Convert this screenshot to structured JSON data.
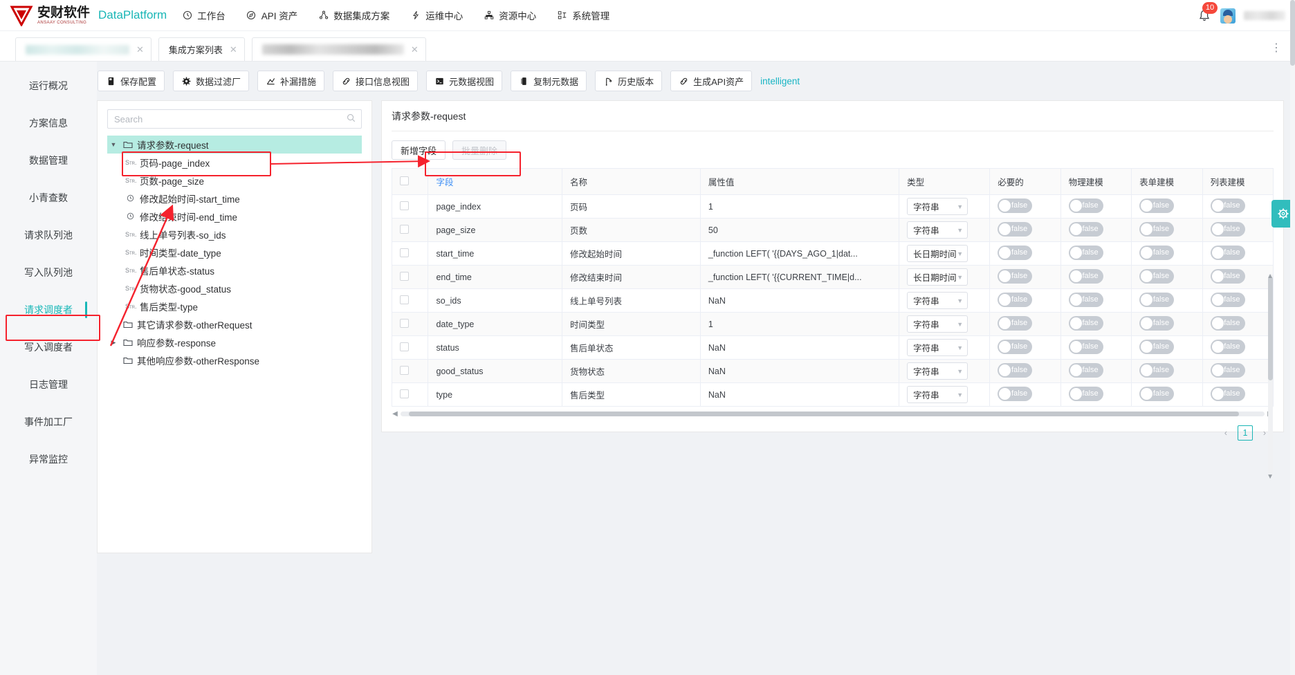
{
  "topnav": {
    "brand_cn": "安财软件",
    "brand_sub": "ANSAAY CONSULTING",
    "brand_platform": "DataPlatform",
    "items": [
      {
        "label": "工作台",
        "icon": "clock-icon"
      },
      {
        "label": "API 资产",
        "icon": "compass-icon"
      },
      {
        "label": "数据集成方案",
        "icon": "sitemap-icon"
      },
      {
        "label": "运维中心",
        "icon": "lightning-icon"
      },
      {
        "label": "资源中心",
        "icon": "hierarchy-icon"
      },
      {
        "label": "系统管理",
        "icon": "grid-icon"
      }
    ],
    "notification_count": "10",
    "bell_icon": "bell-icon",
    "avatar_icon": "user-avatar"
  },
  "tabs": {
    "items": [
      {
        "label": "",
        "blurred": true,
        "closable": true
      },
      {
        "label": "集成方案列表",
        "blurred": false,
        "closable": true
      },
      {
        "label": "",
        "blurred": true,
        "closable": true
      }
    ],
    "more_icon": "more-vertical-icon"
  },
  "sidebar": {
    "items": [
      {
        "label": "运行概况",
        "active": false
      },
      {
        "label": "方案信息",
        "active": false
      },
      {
        "label": "数据管理",
        "active": false
      },
      {
        "label": "小青查数",
        "active": false
      },
      {
        "label": "请求队列池",
        "active": false
      },
      {
        "label": "写入队列池",
        "active": false
      },
      {
        "label": "请求调度者",
        "active": true
      },
      {
        "label": "写入调度者",
        "active": false
      },
      {
        "label": "日志管理",
        "active": false
      },
      {
        "label": "事件加工厂",
        "active": false
      },
      {
        "label": "异常监控",
        "active": false
      }
    ]
  },
  "toolbar": {
    "buttons": [
      {
        "label": "保存配置",
        "icon": "save-icon"
      },
      {
        "label": "数据过滤厂",
        "icon": "gear-icon"
      },
      {
        "label": "补漏措施",
        "icon": "chart-icon"
      },
      {
        "label": "接口信息视图",
        "icon": "link-icon"
      },
      {
        "label": "元数据视图",
        "icon": "terminal-icon"
      },
      {
        "label": "复制元数据",
        "icon": "copy-icon"
      },
      {
        "label": "历史版本",
        "icon": "branch-icon"
      },
      {
        "label": "生成API资产",
        "icon": "link-icon"
      }
    ],
    "intelligent_label": "intelligent"
  },
  "tree": {
    "search_placeholder": "Search",
    "search_value": "",
    "search_icon": "search-icon",
    "nodes": [
      {
        "label": "请求参数-request",
        "type": "folder",
        "expanded": true,
        "selected": true,
        "depth": 0
      },
      {
        "label": "页码-page_index",
        "type": "str",
        "depth": 1
      },
      {
        "label": "页数-page_size",
        "type": "str",
        "depth": 1
      },
      {
        "label": "修改起始时间-start_time",
        "type": "time",
        "depth": 1
      },
      {
        "label": "修改结束时间-end_time",
        "type": "time",
        "depth": 1
      },
      {
        "label": "线上单号列表-so_ids",
        "type": "str",
        "depth": 1
      },
      {
        "label": "时间类型-date_type",
        "type": "str",
        "depth": 1
      },
      {
        "label": "售后单状态-status",
        "type": "str",
        "depth": 1
      },
      {
        "label": "货物状态-good_status",
        "type": "str",
        "depth": 1
      },
      {
        "label": "售后类型-type",
        "type": "str",
        "depth": 1
      },
      {
        "label": "其它请求参数-otherRequest",
        "type": "folder",
        "expanded": false,
        "depth": 0
      },
      {
        "label": "响应参数-response",
        "type": "folder",
        "expanded": false,
        "collapsible": true,
        "depth": 0
      },
      {
        "label": "其他响应参数-otherResponse",
        "type": "folder",
        "expanded": false,
        "depth": 0
      }
    ],
    "str_tag": "Str.",
    "folder_icon": "folder-icon",
    "clock_icon": "clock-icon"
  },
  "detail": {
    "title": "请求参数-request",
    "add_field_label": "新增字段",
    "batch_delete_label": "批量删除",
    "columns": [
      "字段",
      "名称",
      "属性值",
      "类型",
      "必要的",
      "物理建模",
      "表单建模",
      "列表建模"
    ],
    "rows": [
      {
        "field": "page_index",
        "name": "页码",
        "value": "1",
        "type": "字符串",
        "required": "false",
        "physical": "false",
        "form": "false",
        "list": "false"
      },
      {
        "field": "page_size",
        "name": "页数",
        "value": "50",
        "type": "字符串",
        "required": "false",
        "physical": "false",
        "form": "false",
        "list": "false"
      },
      {
        "field": "start_time",
        "name": "修改起始时间",
        "value": "_function LEFT( '{{DAYS_AGO_1|dat...",
        "type": "长日期时间",
        "required": "false",
        "physical": "false",
        "form": "false",
        "list": "false"
      },
      {
        "field": "end_time",
        "name": "修改结束时间",
        "value": "_function LEFT( '{{CURRENT_TIME|d...",
        "type": "长日期时间",
        "required": "false",
        "physical": "false",
        "form": "false",
        "list": "false"
      },
      {
        "field": "so_ids",
        "name": "线上单号列表",
        "value": "NaN",
        "type": "字符串",
        "required": "false",
        "physical": "false",
        "form": "false",
        "list": "false"
      },
      {
        "field": "date_type",
        "name": "时间类型",
        "value": "1",
        "type": "字符串",
        "required": "false",
        "physical": "false",
        "form": "false",
        "list": "false"
      },
      {
        "field": "status",
        "name": "售后单状态",
        "value": "NaN",
        "type": "字符串",
        "required": "false",
        "physical": "false",
        "form": "false",
        "list": "false"
      },
      {
        "field": "good_status",
        "name": "货物状态",
        "value": "NaN",
        "type": "字符串",
        "required": "false",
        "physical": "false",
        "form": "false",
        "list": "false"
      },
      {
        "field": "type",
        "name": "售后类型",
        "value": "NaN",
        "type": "字符串",
        "required": "false",
        "physical": "false",
        "form": "false",
        "list": "false"
      }
    ],
    "pagination": {
      "prev": "‹",
      "current": "1",
      "next": "›"
    },
    "settings_icon": "gear-icon"
  },
  "colors": {
    "accent": "#19b6b6",
    "selected_row": "#b6ece2",
    "annotation": "#f5222d",
    "link": "#3c8ef5",
    "value_text": "#1fb2b6"
  }
}
